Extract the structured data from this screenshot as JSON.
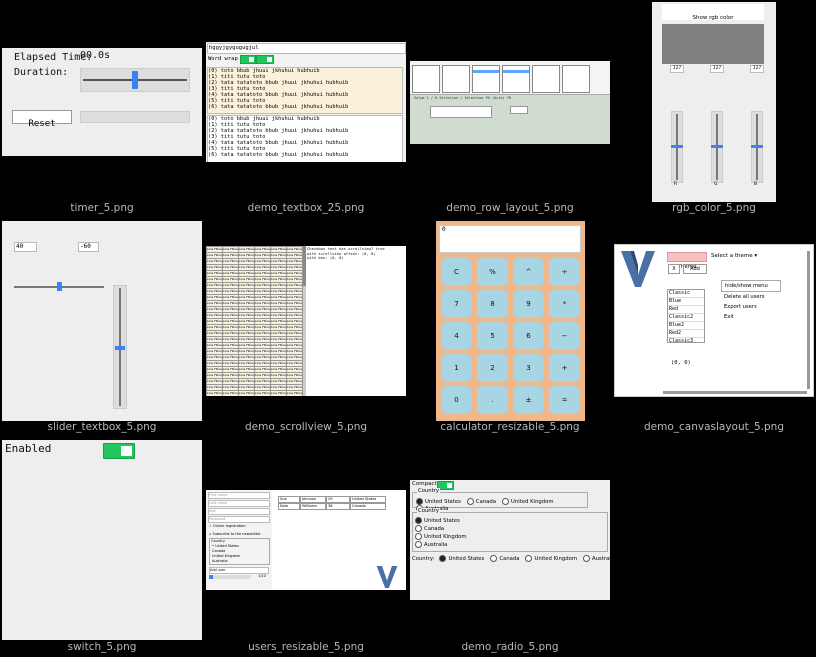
{
  "captions": [
    "timer_5.png",
    "demo_textbox_25.png",
    "demo_row_layout_5.png",
    "rgb_color_5.png",
    "slider_textbox_5.png",
    "demo_scrollview_5.png",
    "calculator_resizable_5.png",
    "demo_canvaslayout_5.png",
    "switch_5.png",
    "users_resizable_5.png",
    "demo_radio_5.png"
  ],
  "timer": {
    "elapsed_label": "Elapsed Time:",
    "elapsed_value": "00.0s",
    "duration_label": "Duration:",
    "reset_label": "Reset",
    "duration_fraction": 0.5,
    "progress_fraction": 0.0
  },
  "textbox": {
    "input_value": "hggyjgygugugjul",
    "wrap_label": "Word wrap",
    "lines": [
      "(0) toto bbub jhuui jkhuhui hubhuib",
      "(1) titi tutu toto",
      "(2) tata tatatoto bbub jhuui jkhuhui hubhuib",
      "(3) titi tutu toto",
      "(4) tata tatatoto bbub jhuui jkhuhui hubhuib",
      "(5) titi tutu toto",
      "(6) tata tatatoto bbub jhuui jkhuhui hubhuib"
    ]
  },
  "row_layout": {
    "footer_text": "Value 1 / 0 Selection / Selection PG (Acta) 70"
  },
  "rgb": {
    "button_label": "Show rgb color",
    "values": [
      "127",
      "127",
      "127"
    ],
    "channels": [
      "R",
      "G",
      "B"
    ],
    "level_fraction": 0.5,
    "swatch_color": "#7f7f7f"
  },
  "slider_textbox": {
    "h_value": "40",
    "v_value": "-60",
    "h_fraction": 0.5,
    "v_fraction": 0.5
  },
  "scrollview": {
    "cell_text": "Line  Fillne",
    "info": [
      "Checkbox text has scrollview? true",
      "",
      "with scrollview offset: (0, 0)",
      "with box: (0, 0)"
    ]
  },
  "calculator": {
    "display": "0",
    "rows": [
      [
        "C",
        "%",
        "^",
        "÷"
      ],
      [
        "7",
        "8",
        "9",
        "*"
      ],
      [
        "4",
        "5",
        "6",
        "−"
      ],
      [
        "1",
        "2",
        "3",
        "+"
      ],
      [
        "0",
        ".",
        "±",
        "="
      ]
    ]
  },
  "canvas": {
    "theme_button": "Theme",
    "select_label": "Select a theme",
    "x_button": "X",
    "add_button": "Add",
    "themes": [
      "Classic",
      "Blue",
      "Red",
      "Classic2",
      "Blue2",
      "Red2",
      "Classic3"
    ],
    "menu": [
      "hide/show menu",
      "Delete all users",
      "Export users",
      "Exit"
    ],
    "coords": "(0, 0)"
  },
  "switch": {
    "label": "Enabled"
  },
  "users": {
    "placeholders": [
      "First name",
      "Last name",
      "Age",
      "Password"
    ],
    "online_label": "Online registration",
    "newsletter_label": "Subscribe to the newsletter",
    "country_legend": "Country",
    "countries": [
      "United States",
      "Canada",
      "United Kingdom",
      "Australia"
    ],
    "add_button": "Add user",
    "page": "1/10",
    "progress_fraction": 0.1,
    "table": [
      [
        "Sue",
        "Johnson",
        "29",
        "United States"
      ],
      [
        "Kate",
        "Williams",
        "38",
        "Canada"
      ]
    ]
  },
  "radio": {
    "compact_label": "Compact",
    "legend": "Country",
    "footer_label": "Country:",
    "options": [
      "United States",
      "Canada",
      "United Kingdom",
      "Australia"
    ]
  }
}
